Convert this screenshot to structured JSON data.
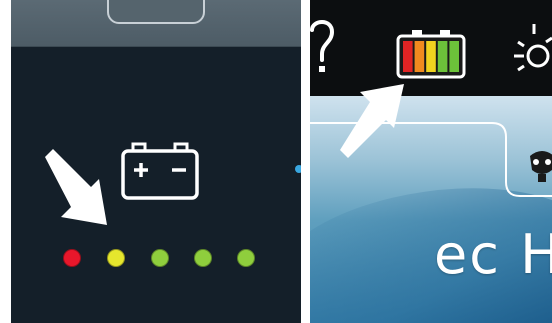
{
  "left_panel": {
    "icon": "battery-icon",
    "indicator_dots": [
      {
        "color": "#e8172b"
      },
      {
        "color": "#e5e62d"
      },
      {
        "color": "#8fce3d"
      },
      {
        "color": "#8fce3d"
      },
      {
        "color": "#8fce3d"
      }
    ]
  },
  "right_panel": {
    "help_icon": "question-mark-icon",
    "battery_level_segments": [
      "#e02424",
      "#f08a1f",
      "#f0d21f",
      "#6cc23a",
      "#6cc23a"
    ],
    "light_icon": "light-icon",
    "brand_text": "ec H"
  },
  "colors": {
    "left_background": "#141f29",
    "right_background": "#0c0e10",
    "arrow": "#ffffff"
  }
}
